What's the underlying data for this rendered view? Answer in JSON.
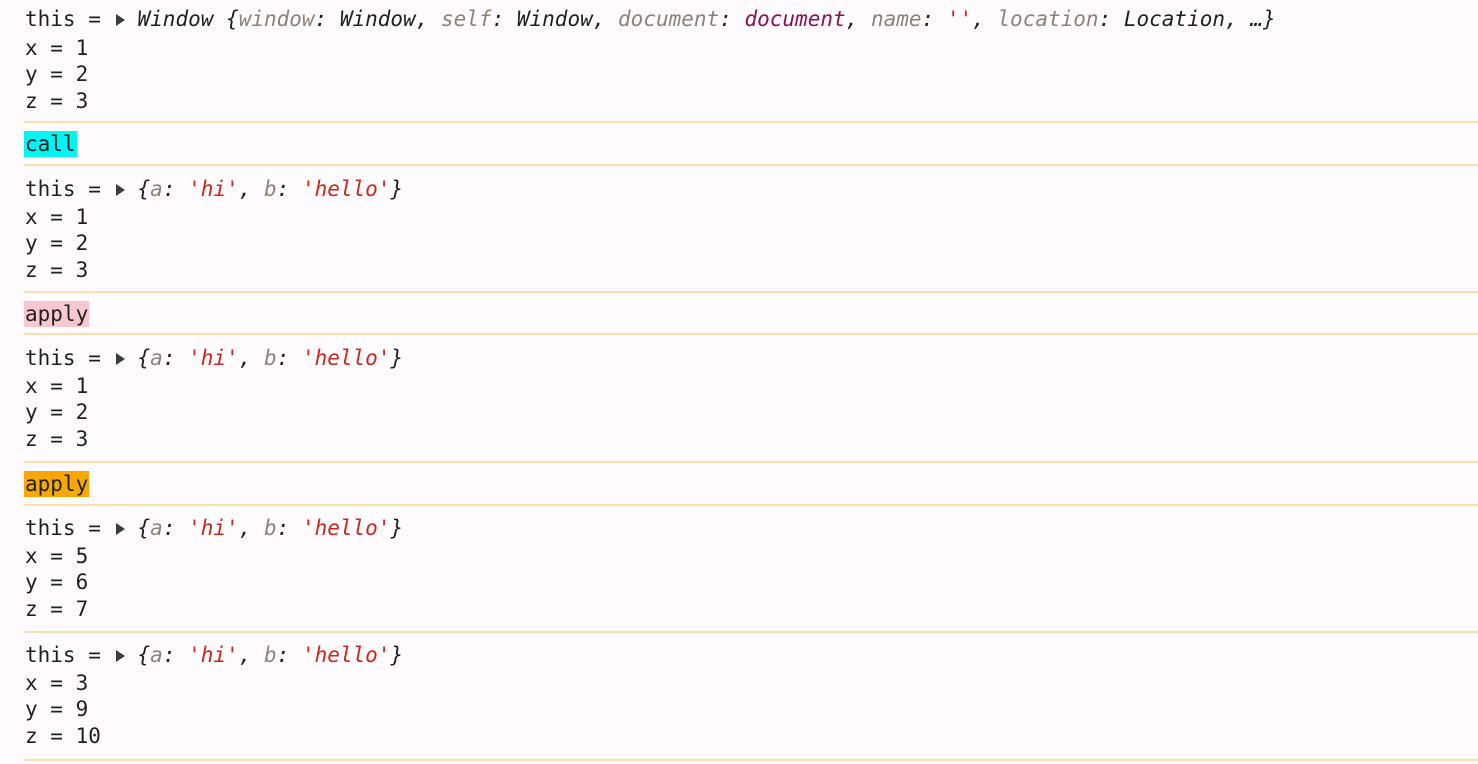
{
  "colors": {
    "background": "#fffbfe",
    "separator": "#f7dfb2",
    "call_tag": "#00f5f2",
    "apply_tag_1": "#f9c7cf",
    "apply_tag_2": "#f6a700",
    "string_value": "#c8281e",
    "property_key": "#8c8278",
    "node_value": "#88104f"
  },
  "icons": {
    "expand": "disclosure-triangle-right-icon"
  },
  "window_log": {
    "this_prefix": "this = ",
    "constructor": "Window",
    "open": "{",
    "props": [
      {
        "key": "window",
        "value": "Window",
        "kind": "plain"
      },
      {
        "key": "self",
        "value": "Window",
        "kind": "plain"
      },
      {
        "key": "document",
        "value": "document",
        "kind": "node"
      },
      {
        "key": "name",
        "value": "''",
        "kind": "string"
      },
      {
        "key": "location",
        "value": "Location",
        "kind": "plain"
      }
    ],
    "ellipsis": "…",
    "close": "}",
    "lines": [
      "x = 1",
      "y = 2",
      "z = 3"
    ]
  },
  "labels": [
    {
      "text": "call",
      "color": "#00f5f2"
    },
    {
      "text": "apply",
      "color": "#f9c7cf"
    },
    {
      "text": "apply",
      "color": "#f6a700"
    }
  ],
  "object_logs": [
    {
      "this_prefix": "this = ",
      "obj": {
        "a_key": "a",
        "a_val": "'hi'",
        "b_key": "b",
        "b_val": "'hello'"
      },
      "lines": [
        "x = 1",
        "y = 2",
        "z = 3"
      ]
    },
    {
      "this_prefix": "this = ",
      "obj": {
        "a_key": "a",
        "a_val": "'hi'",
        "b_key": "b",
        "b_val": "'hello'"
      },
      "lines": [
        "x = 1",
        "y = 2",
        "z = 3"
      ]
    },
    {
      "this_prefix": "this = ",
      "obj": {
        "a_key": "a",
        "a_val": "'hi'",
        "b_key": "b",
        "b_val": "'hello'"
      },
      "lines": [
        "x = 5",
        "y = 6",
        "z = 7"
      ]
    },
    {
      "this_prefix": "this = ",
      "obj": {
        "a_key": "a",
        "a_val": "'hi'",
        "b_key": "b",
        "b_val": "'hello'"
      },
      "lines": [
        "x = 3",
        "y = 9",
        "z = 10"
      ]
    }
  ]
}
